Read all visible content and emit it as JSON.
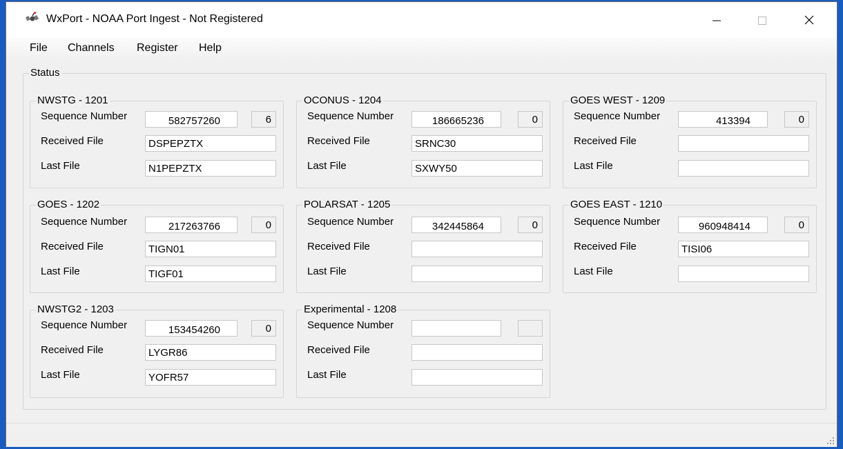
{
  "window": {
    "title": "WxPort - NOAA Port Ingest - Not Registered"
  },
  "menu": [
    "File",
    "Channels",
    "Register",
    "Help"
  ],
  "status_group_title": "Status",
  "labels": {
    "sequence": "Sequence Number",
    "received": "Received File",
    "last": "Last File"
  },
  "channels": {
    "nwstg": {
      "title": "NWSTG - 1201",
      "sequence": "582757260",
      "count": "6",
      "received": "DSPEPZTX",
      "last": "N1PEPZTX"
    },
    "goes": {
      "title": "GOES - 1202",
      "sequence": "217263766",
      "count": "0",
      "received": "TIGN01",
      "last": "TIGF01"
    },
    "nwstg2": {
      "title": "NWSTG2 - 1203",
      "sequence": "153454260",
      "count": "0",
      "received": "LYGR86",
      "last": "YOFR57"
    },
    "oconus": {
      "title": "OCONUS - 1204",
      "sequence": "186665236",
      "count": "0",
      "received": "SRNC30",
      "last": "SXWY50"
    },
    "polarsat": {
      "title": "POLARSAT - 1205",
      "sequence": "342445864",
      "count": "0",
      "received": "",
      "last": ""
    },
    "experimental": {
      "title": "Experimental - 1208",
      "sequence": "",
      "count": "",
      "received": "",
      "last": ""
    },
    "goes_west": {
      "title": "GOES WEST - 1209",
      "sequence": "413394",
      "count": "0",
      "received": "",
      "last": ""
    },
    "goes_east": {
      "title": "GOES EAST - 1210",
      "sequence": "960948414",
      "count": "0",
      "received": "TISI06",
      "last": ""
    }
  },
  "icons": {
    "app": "satellite-icon",
    "minimize": "minimize-icon",
    "maximize": "maximize-icon",
    "close": "close-icon",
    "grip": "resize-grip-icon"
  },
  "colors": {
    "desktop": "#1a5bbf",
    "window_bg": "#f0f0f0",
    "titlebar_bg": "#ffffff"
  }
}
